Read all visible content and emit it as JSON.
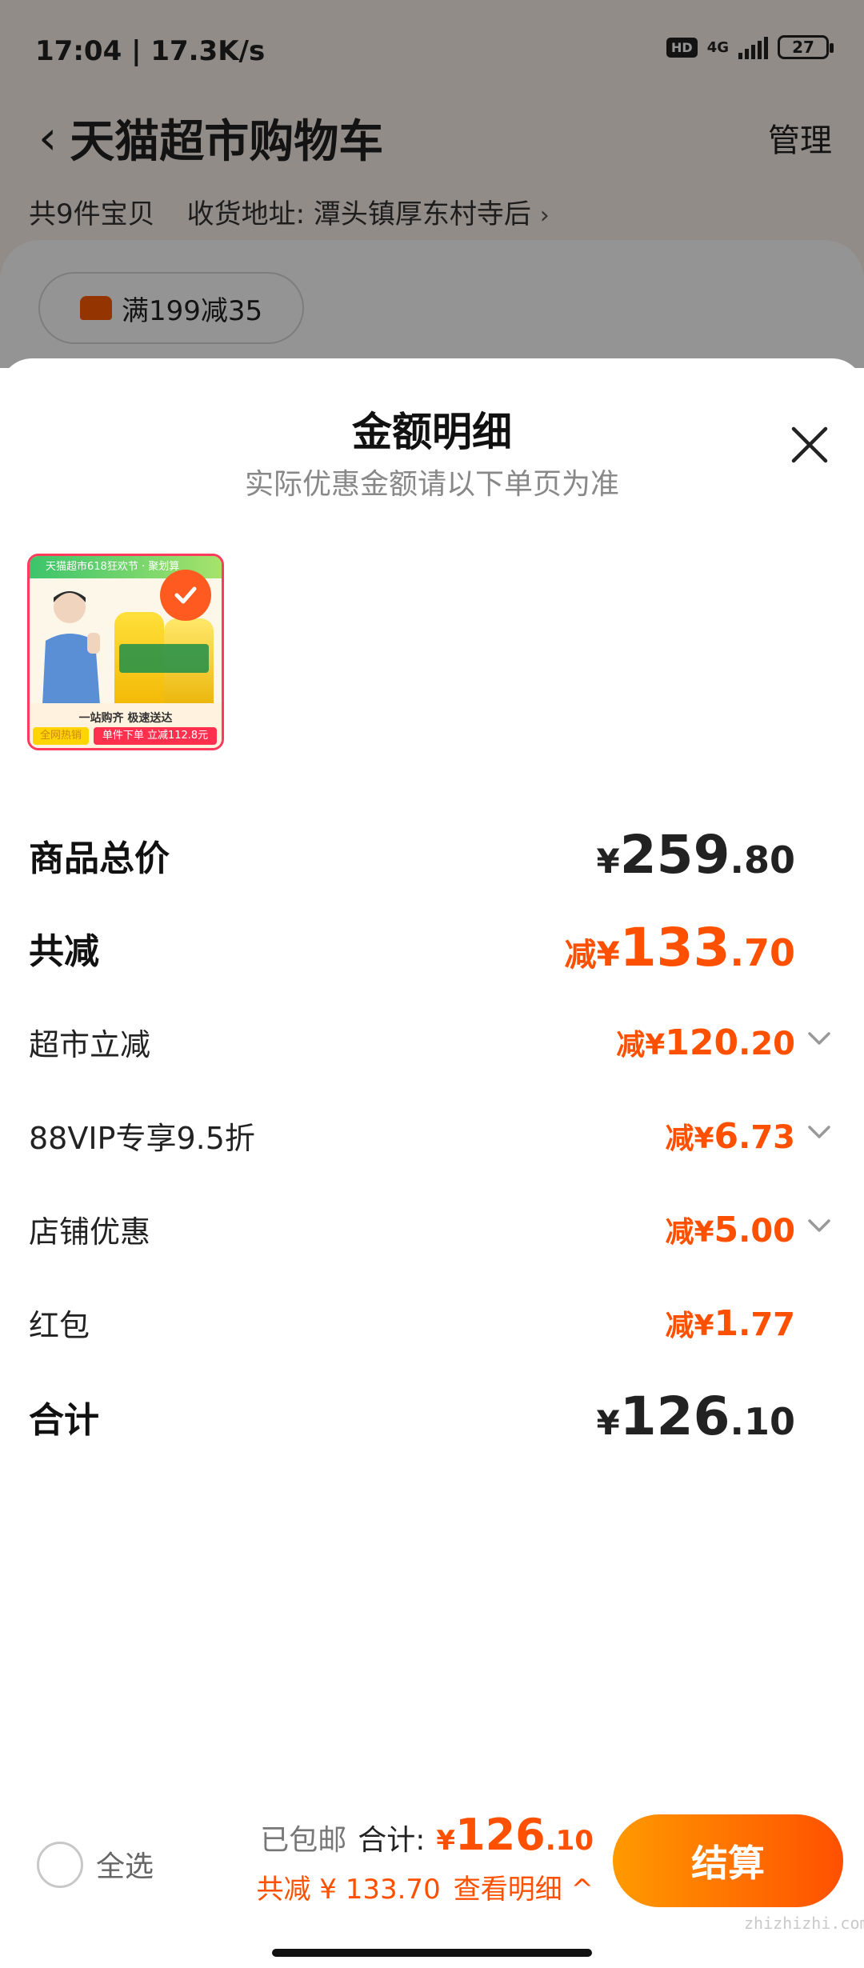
{
  "status_bar": {
    "time_speed": "17:04 | 17.3K/s",
    "hd": "HD",
    "network": "4G",
    "battery": "27"
  },
  "background_page": {
    "title": "天猫超市购物车",
    "manage": "管理",
    "item_count": "共9件宝贝",
    "address": "收货地址: 潭头镇厚东村寺后",
    "promo": "满199减35"
  },
  "sheet": {
    "title": "金额明细",
    "subtitle": "实际优惠金额请以下单页为准",
    "product_image": {
      "banner": "天猫超市618狂欢节 · 聚划算",
      "footer_line1": "一站购齐 极速送达",
      "footer_line2": "单件下单 立减112.8元",
      "hot_tag": "全网热销"
    },
    "rows": {
      "total_price": {
        "label": "商品总价",
        "symbol": "¥",
        "int": "259",
        "dec": ".80"
      },
      "total_discount": {
        "label": "共减",
        "prefix": "减",
        "symbol": "¥",
        "int": "133",
        "dec": ".70"
      },
      "market_discount": {
        "label": "超市立减",
        "prefix": "减",
        "symbol": "¥",
        "int": "120",
        "dec": ".20"
      },
      "vip_discount": {
        "label": "88VIP专享9.5折",
        "prefix": "减",
        "symbol": "¥",
        "int": "6",
        "dec": ".73"
      },
      "store_discount": {
        "label": "店铺优惠",
        "prefix": "减",
        "symbol": "¥",
        "int": "5",
        "dec": ".00"
      },
      "red_packet": {
        "label": "红包",
        "prefix": "减",
        "symbol": "¥",
        "int": "1",
        "dec": ".77"
      },
      "sum": {
        "label": "合计",
        "symbol": "¥",
        "int": "126",
        "dec": ".10"
      }
    }
  },
  "bottom_bar": {
    "select_all": "全选",
    "free_shipping": "已包邮",
    "total_label": "合计:",
    "total_symbol": "¥",
    "total_int": "126",
    "total_dec": ".10",
    "discount_text": "共减 ¥ 133.70",
    "view_detail": "查看明细 ^",
    "checkout": "结算"
  },
  "watermark": "zhizhizhi.com",
  "colors": {
    "accent_orange": "#ff5000",
    "checkout_gradient_start": "#ff9a00",
    "checkout_gradient_end": "#ff5000"
  }
}
